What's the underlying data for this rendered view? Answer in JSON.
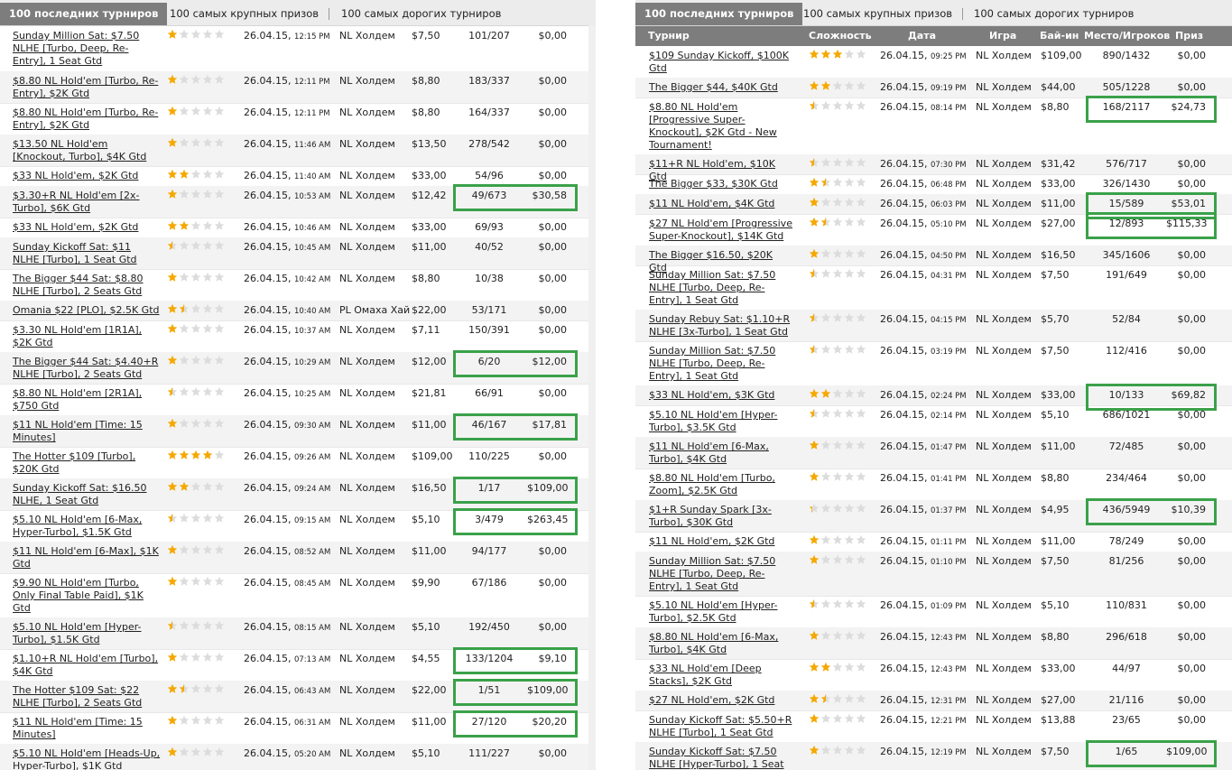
{
  "colors": {
    "star_full": "#f5a800",
    "star_empty": "#dcdcdc",
    "highlight": "#3aa14a",
    "header_bg": "#7d7d7d"
  },
  "tabs": {
    "t1": "100 последних турниров",
    "t2": "100 самых крупных призов",
    "t3": "100 самых дорогих турниров"
  },
  "headers": {
    "name": "Турнир",
    "difficulty": "Сложность",
    "date": "Дата",
    "game": "Игра",
    "buyin": "Бай-ин",
    "place": "Место/Игроков",
    "prize": "Приз"
  },
  "left_rows": [
    {
      "name": "Sunday Million Sat: $7.50 NLHE [Turbo, Deep, Re-Entry], 1 Seat Gtd",
      "stars": 1,
      "date": "26.04.15,",
      "time": "12:15 PM",
      "game": "NL Холдем",
      "buyin": "$7,50",
      "place": "101/207",
      "prize": "$0,00",
      "win": false
    },
    {
      "name": "$8.80 NL Hold'em [Turbo, Re-Entry], $2K Gtd",
      "stars": 1,
      "date": "26.04.15,",
      "time": "12:11 PM",
      "game": "NL Холдем",
      "buyin": "$8,80",
      "place": "183/337",
      "prize": "$0,00",
      "win": false
    },
    {
      "name": "$8.80 NL Hold'em [Turbo, Re-Entry], $2K Gtd",
      "stars": 1,
      "date": "26.04.15,",
      "time": "12:11 PM",
      "game": "NL Холдем",
      "buyin": "$8,80",
      "place": "164/337",
      "prize": "$0,00",
      "win": false
    },
    {
      "name": "$13.50 NL Hold'em [Knockout, Turbo], $4K Gtd",
      "stars": 1,
      "date": "26.04.15,",
      "time": "11:46 AM",
      "game": "NL Холдем",
      "buyin": "$13,50",
      "place": "278/542",
      "prize": "$0,00",
      "win": false
    },
    {
      "name": "$33 NL Hold'em, $2K Gtd",
      "stars": 2,
      "date": "26.04.15,",
      "time": "11:40 AM",
      "game": "NL Холдем",
      "buyin": "$33,00",
      "place": "54/96",
      "prize": "$0,00",
      "win": false
    },
    {
      "name": "$3.30+R NL Hold'em [2x-Turbo], $6K Gtd",
      "stars": 1,
      "date": "26.04.15,",
      "time": "10:53 AM",
      "game": "NL Холдем",
      "buyin": "$12,42",
      "place": "49/673",
      "prize": "$30,58",
      "win": true
    },
    {
      "name": "$33 NL Hold'em, $2K Gtd",
      "stars": 2,
      "date": "26.04.15,",
      "time": "10:46 AM",
      "game": "NL Холдем",
      "buyin": "$33,00",
      "place": "69/93",
      "prize": "$0,00",
      "win": false
    },
    {
      "name": "Sunday Kickoff Sat: $11 NLHE [Turbo], 1 Seat Gtd",
      "stars": 0.5,
      "date": "26.04.15,",
      "time": "10:45 AM",
      "game": "NL Холдем",
      "buyin": "$11,00",
      "place": "40/52",
      "prize": "$0,00",
      "win": false
    },
    {
      "name": "The Bigger $44 Sat: $8.80 NLHE [Turbo], 2 Seats Gtd",
      "stars": 1,
      "date": "26.04.15,",
      "time": "10:42 AM",
      "game": "NL Холдем",
      "buyin": "$8,80",
      "place": "10/38",
      "prize": "$0,00",
      "win": false
    },
    {
      "name": "Omania $22 [PLO], $2.5K Gtd",
      "stars": 1.5,
      "date": "26.04.15,",
      "time": "10:40 AM",
      "game": "PL Омаха Хай",
      "buyin": "$22,00",
      "place": "53/171",
      "prize": "$0,00",
      "win": false
    },
    {
      "name": "$3.30 NL Hold'em [1R1A], $2K Gtd",
      "stars": 1,
      "date": "26.04.15,",
      "time": "10:37 AM",
      "game": "NL Холдем",
      "buyin": "$7,11",
      "place": "150/391",
      "prize": "$0,00",
      "win": false
    },
    {
      "name": "The Bigger $44 Sat: $4.40+R NLHE [Turbo], 2 Seats Gtd",
      "stars": 1,
      "date": "26.04.15,",
      "time": "10:29 AM",
      "game": "NL Холдем",
      "buyin": "$12,00",
      "place": "6/20",
      "prize": "$12,00",
      "win": true
    },
    {
      "name": "$8.80 NL Hold'em [2R1A], $750 Gtd",
      "stars": 0.5,
      "date": "26.04.15,",
      "time": "10:25 AM",
      "game": "NL Холдем",
      "buyin": "$21,81",
      "place": "66/91",
      "prize": "$0,00",
      "win": false
    },
    {
      "name": "$11 NL Hold'em [Time: 15 Minutes]",
      "stars": 1,
      "date": "26.04.15,",
      "time": "09:30 AM",
      "game": "NL Холдем",
      "buyin": "$11,00",
      "place": "46/167",
      "prize": "$17,81",
      "win": true
    },
    {
      "name": "The Hotter $109 [Turbo], $20K Gtd",
      "stars": 4,
      "date": "26.04.15,",
      "time": "09:26 AM",
      "game": "NL Холдем",
      "buyin": "$109,00",
      "place": "110/225",
      "prize": "$0,00",
      "win": false
    },
    {
      "name": "Sunday Kickoff Sat: $16.50 NLHE, 1 Seat Gtd",
      "stars": 2,
      "date": "26.04.15,",
      "time": "09:24 AM",
      "game": "NL Холдем",
      "buyin": "$16,50",
      "place": "1/17",
      "prize": "$109,00",
      "win": true
    },
    {
      "name": "$5.10 NL Hold'em [6-Max, Hyper-Turbo], $1.5K Gtd",
      "stars": 0.5,
      "date": "26.04.15,",
      "time": "09:15 AM",
      "game": "NL Холдем",
      "buyin": "$5,10",
      "place": "3/479",
      "prize": "$263,45",
      "win": true
    },
    {
      "name": "$11 NL Hold'em [6-Max], $1K Gtd",
      "stars": 1,
      "date": "26.04.15,",
      "time": "08:52 AM",
      "game": "NL Холдем",
      "buyin": "$11,00",
      "place": "94/177",
      "prize": "$0,00",
      "win": false
    },
    {
      "name": "$9.90 NL Hold'em [Turbo, Only Final Table Paid], $1K Gtd",
      "stars": 1,
      "date": "26.04.15,",
      "time": "08:45 AM",
      "game": "NL Холдем",
      "buyin": "$9,90",
      "place": "67/186",
      "prize": "$0,00",
      "win": false
    },
    {
      "name": "$5.10 NL Hold'em [Hyper-Turbo], $1.5K Gtd",
      "stars": 0.5,
      "date": "26.04.15,",
      "time": "08:15 AM",
      "game": "NL Холдем",
      "buyin": "$5,10",
      "place": "192/450",
      "prize": "$0,00",
      "win": false
    },
    {
      "name": "$1.10+R NL Hold'em [Turbo], $4K Gtd",
      "stars": 1,
      "date": "26.04.15,",
      "time": "07:13 AM",
      "game": "NL Холдем",
      "buyin": "$4,55",
      "place": "133/1204",
      "prize": "$9,10",
      "win": true
    },
    {
      "name": "The Hotter $109 Sat: $22 NLHE [Turbo], 2 Seats Gtd",
      "stars": 1.5,
      "date": "26.04.15,",
      "time": "06:43 AM",
      "game": "NL Холдем",
      "buyin": "$22,00",
      "place": "1/51",
      "prize": "$109,00",
      "win": true
    },
    {
      "name": "$11 NL Hold'em [Time: 15 Minutes]",
      "stars": 1,
      "date": "26.04.15,",
      "time": "06:31 AM",
      "game": "NL Холдем",
      "buyin": "$11,00",
      "place": "27/120",
      "prize": "$20,20",
      "win": true
    },
    {
      "name": "$5.10 NL Hold'em [Heads-Up, Hyper-Turbo], $1K Gtd",
      "stars": 1,
      "date": "26.04.15,",
      "time": "05:20 AM",
      "game": "NL Холдем",
      "buyin": "$5,10",
      "place": "111/227",
      "prize": "$0,00",
      "win": false
    }
  ],
  "right_rows": [
    {
      "name": "$109 Sunday Kickoff, $100K Gtd",
      "stars": 3,
      "date": "26.04.15,",
      "time": "09:25 PM",
      "game": "NL Холдем",
      "buyin": "$109,00",
      "place": "890/1432",
      "prize": "$0,00",
      "win": false
    },
    {
      "name": "The Bigger $44, $40K Gtd",
      "stars": 2,
      "date": "26.04.15,",
      "time": "09:19 PM",
      "game": "NL Холдем",
      "buyin": "$44,00",
      "place": "505/1228",
      "prize": "$0,00",
      "win": false
    },
    {
      "name": "$8.80 NL Hold'em [Progressive Super-Knockout], $2K Gtd - New Tournament!",
      "stars": 0.5,
      "date": "26.04.15,",
      "time": "08:14 PM",
      "game": "NL Холдем",
      "buyin": "$8,80",
      "place": "168/2117",
      "prize": "$24,73",
      "win": true
    },
    {
      "name": "$11+R NL Hold'em, $10K Gtd",
      "stars": 0.5,
      "date": "26.04.15,",
      "time": "07:30 PM",
      "game": "NL Холдем",
      "buyin": "$31,42",
      "place": "576/717",
      "prize": "$0,00",
      "win": false
    },
    {
      "name": "The Bigger $33, $30K Gtd",
      "stars": 1.5,
      "date": "26.04.15,",
      "time": "06:48 PM",
      "game": "NL Холдем",
      "buyin": "$33,00",
      "place": "326/1430",
      "prize": "$0,00",
      "win": false
    },
    {
      "name": "$11 NL Hold'em, $4K Gtd",
      "stars": 1,
      "date": "26.04.15,",
      "time": "06:03 PM",
      "game": "NL Холдем",
      "buyin": "$11,00",
      "place": "15/589",
      "prize": "$53,01",
      "win": true
    },
    {
      "name": "$27 NL Hold'em [Progressive Super-Knockout], $14K Gtd",
      "stars": 1.5,
      "date": "26.04.15,",
      "time": "05:10 PM",
      "game": "NL Холдем",
      "buyin": "$27,00",
      "place": "12/893",
      "prize": "$115,33",
      "win": true
    },
    {
      "name": "The Bigger $16.50, $20K Gtd",
      "stars": 1,
      "date": "26.04.15,",
      "time": "04:50 PM",
      "game": "NL Холдем",
      "buyin": "$16,50",
      "place": "345/1606",
      "prize": "$0,00",
      "win": false
    },
    {
      "name": "Sunday Million Sat: $7.50 NLHE [Turbo, Deep, Re-Entry], 1 Seat Gtd",
      "stars": 0.5,
      "date": "26.04.15,",
      "time": "04:31 PM",
      "game": "NL Холдем",
      "buyin": "$7,50",
      "place": "191/649",
      "prize": "$0,00",
      "win": false
    },
    {
      "name": "Sunday Rebuy Sat: $1.10+R NLHE [3x-Turbo], 1 Seat Gtd",
      "stars": 0.5,
      "date": "26.04.15,",
      "time": "04:15 PM",
      "game": "NL Холдем",
      "buyin": "$5,70",
      "place": "52/84",
      "prize": "$0,00",
      "win": false
    },
    {
      "name": "Sunday Million Sat: $7.50 NLHE [Turbo, Deep, Re-Entry], 1 Seat Gtd",
      "stars": 0.5,
      "date": "26.04.15,",
      "time": "03:19 PM",
      "game": "NL Холдем",
      "buyin": "$7,50",
      "place": "112/416",
      "prize": "$0,00",
      "win": false
    },
    {
      "name": "$33 NL Hold'em, $3K Gtd",
      "stars": 2,
      "date": "26.04.15,",
      "time": "02:24 PM",
      "game": "NL Холдем",
      "buyin": "$33,00",
      "place": "10/133",
      "prize": "$69,82",
      "win": true
    },
    {
      "name": "$5.10 NL Hold'em [Hyper-Turbo], $3.5K Gtd",
      "stars": 0.5,
      "date": "26.04.15,",
      "time": "02:14 PM",
      "game": "NL Холдем",
      "buyin": "$5,10",
      "place": "686/1021",
      "prize": "$0,00",
      "win": false
    },
    {
      "name": "$11 NL Hold'em [6-Max, Turbo], $4K Gtd",
      "stars": 1,
      "date": "26.04.15,",
      "time": "01:47 PM",
      "game": "NL Холдем",
      "buyin": "$11,00",
      "place": "72/485",
      "prize": "$0,00",
      "win": false
    },
    {
      "name": "$8.80 NL Hold'em [Turbo, Zoom], $2.5K Gtd",
      "stars": 1,
      "date": "26.04.15,",
      "time": "01:41 PM",
      "game": "NL Холдем",
      "buyin": "$8,80",
      "place": "234/464",
      "prize": "$0,00",
      "win": false
    },
    {
      "name": "$1+R Sunday Spark [3x-Turbo], $30K Gtd",
      "stars": 0.3,
      "date": "26.04.15,",
      "time": "01:37 PM",
      "game": "NL Холдем",
      "buyin": "$4,95",
      "place": "436/5949",
      "prize": "$10,39",
      "win": true
    },
    {
      "name": "$11 NL Hold'em, $2K Gtd",
      "stars": 1,
      "date": "26.04.15,",
      "time": "01:11 PM",
      "game": "NL Холдем",
      "buyin": "$11,00",
      "place": "78/249",
      "prize": "$0,00",
      "win": false
    },
    {
      "name": "Sunday Million Sat: $7.50 NLHE [Turbo, Deep, Re-Entry], 1 Seat Gtd",
      "stars": 1,
      "date": "26.04.15,",
      "time": "01:10 PM",
      "game": "NL Холдем",
      "buyin": "$7,50",
      "place": "81/256",
      "prize": "$0,00",
      "win": false
    },
    {
      "name": "$5.10 NL Hold'em [Hyper-Turbo], $2.5K Gtd",
      "stars": 0.5,
      "date": "26.04.15,",
      "time": "01:09 PM",
      "game": "NL Холдем",
      "buyin": "$5,10",
      "place": "110/831",
      "prize": "$0,00",
      "win": false
    },
    {
      "name": "$8.80 NL Hold'em [6-Max, Turbo], $4K Gtd",
      "stars": 1,
      "date": "26.04.15,",
      "time": "12:43 PM",
      "game": "NL Холдем",
      "buyin": "$8,80",
      "place": "296/618",
      "prize": "$0,00",
      "win": false
    },
    {
      "name": "$33 NL Hold'em [Deep Stacks], $2K Gtd",
      "stars": 2,
      "date": "26.04.15,",
      "time": "12:43 PM",
      "game": "NL Холдем",
      "buyin": "$33,00",
      "place": "44/97",
      "prize": "$0,00",
      "win": false
    },
    {
      "name": "$27 NL Hold'em, $2K Gtd",
      "stars": 1.5,
      "date": "26.04.15,",
      "time": "12:31 PM",
      "game": "NL Холдем",
      "buyin": "$27,00",
      "place": "21/116",
      "prize": "$0,00",
      "win": false
    },
    {
      "name": "Sunday Kickoff Sat: $5.50+R NLHE [Turbo], 1 Seat Gtd",
      "stars": 1,
      "date": "26.04.15,",
      "time": "12:21 PM",
      "game": "NL Холдем",
      "buyin": "$13,88",
      "place": "23/65",
      "prize": "$0,00",
      "win": false
    },
    {
      "name": "Sunday Kickoff Sat: $7.50 NLHE [Hyper-Turbo], 1 Seat",
      "stars": 1,
      "date": "26.04.15,",
      "time": "12:19 PM",
      "game": "NL Холдем",
      "buyin": "$7,50",
      "place": "1/65",
      "prize": "$109,00",
      "win": true
    }
  ]
}
